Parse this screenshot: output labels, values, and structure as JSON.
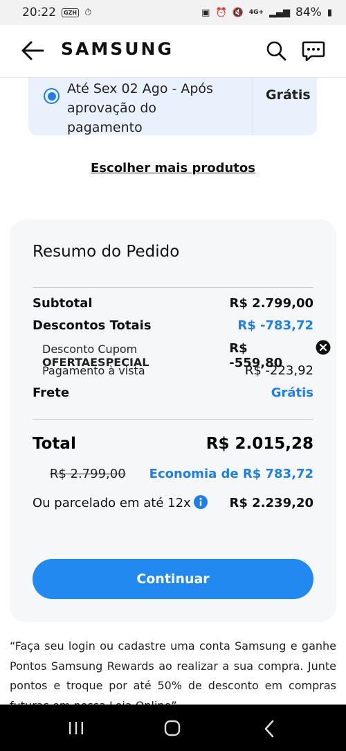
{
  "status_bar": {
    "time": "20:22",
    "badge": "GZH",
    "network": "4G+",
    "battery": "84%"
  },
  "header": {
    "brand": "SAMSUNG"
  },
  "shipping_option": {
    "text": "Até Sex 02 Ago - Após aprovação do pagamento",
    "price": "Grátis",
    "selected": true
  },
  "more_products_link": "Escolher mais produtos",
  "summary": {
    "title": "Resumo do Pedido",
    "subtotal_label": "Subtotal",
    "subtotal_value": "R$ 2.799,00",
    "discounts_label": "Descontos Totais",
    "discounts_value": "R$ -783,72",
    "coupon_label": "Desconto Cupom",
    "coupon_code": "OFERTAESPECIAL",
    "coupon_value": "R$ -559,80",
    "cash_label": "Pagamento à vista",
    "cash_value": "R$ -223,92",
    "shipping_label": "Frete",
    "shipping_value": "Grátis",
    "total_label": "Total",
    "total_value": "R$ 2.015,28",
    "original_price": "R$ 2.799,00",
    "savings": "Economia de R$ 783,72",
    "installments_label": "Ou parcelado em até 12x",
    "installments_value": "R$ 2.239,20",
    "continue_label": "Continuar"
  },
  "promo_text": "“Faça seu login ou cadastre uma conta Samsung e ganhe Pontos Samsung Rewards ao realizar a sua compra. Junte pontos e troque por até 50% de desconto em compras futuras em nossa Loja Online”",
  "colors": {
    "accent": "#1f7fe8",
    "button": "#2189f0",
    "card_bg": "#f6f7f8",
    "shipping_bg": "#e9f2fc"
  }
}
